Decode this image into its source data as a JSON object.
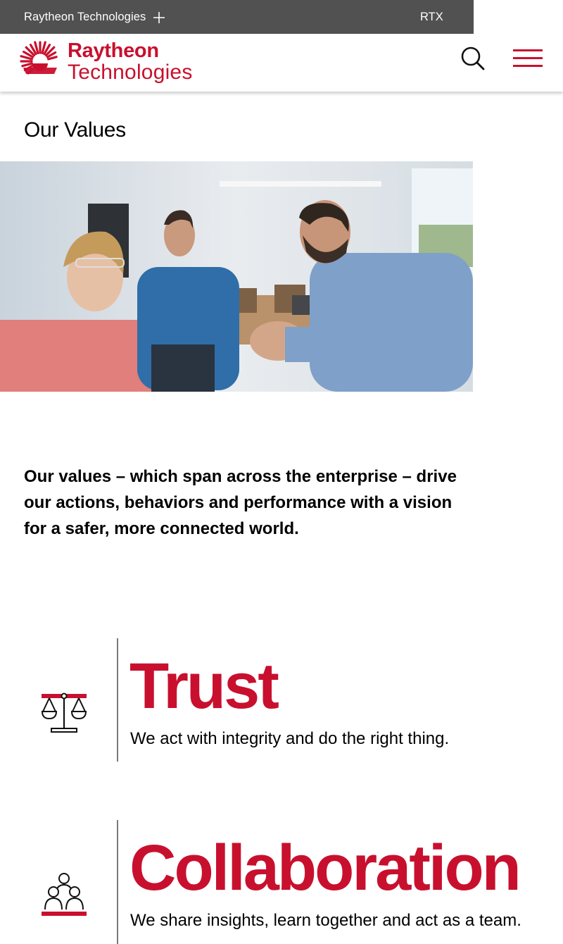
{
  "topbar": {
    "brand_label": "Raytheon Technologies",
    "rtx_label": "RTX"
  },
  "header": {
    "logo_line1": "Raytheon",
    "logo_line2": "Technologies",
    "icons": {
      "search": "search-icon",
      "menu": "hamburger-menu-icon"
    }
  },
  "page": {
    "title": "Our Values",
    "hero_image": "photo of three colleagues writing on a glass board in a conference room",
    "intro": "Our values – which span across the enterprise – drive our actions, behaviors and performance with a vision for a safer, more connected world."
  },
  "values": [
    {
      "title": "Trust",
      "text": "We act with integrity and do the right thing.",
      "icon": "scales-icon"
    },
    {
      "title": "Collaboration",
      "text": "We share insights, learn together and act as a team.",
      "icon": "people-group-icon"
    }
  ],
  "colors": {
    "brand_red": "#c8102e",
    "topbar_gray": "#515151"
  }
}
